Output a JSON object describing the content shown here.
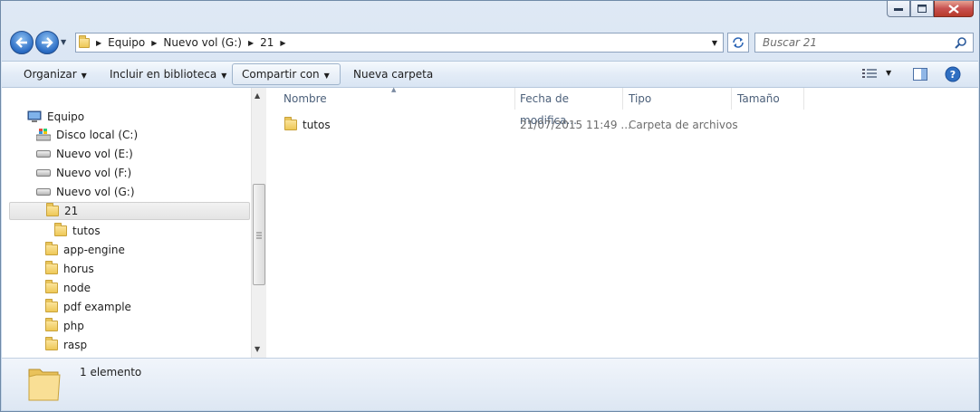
{
  "address": {
    "crumbs": [
      "Equipo",
      "Nuevo vol (G:)",
      "21"
    ]
  },
  "search": {
    "placeholder": "Buscar 21"
  },
  "toolbar": {
    "organize": "Organizar",
    "include_library": "Incluir en biblioteca",
    "share": "Compartir con",
    "new_folder": "Nueva carpeta"
  },
  "tree": [
    {
      "label": "Equipo",
      "icon": "computer-icon"
    },
    {
      "label": "Disco local (C:)",
      "icon": "drive-windows-icon"
    },
    {
      "label": "Nuevo vol (E:)",
      "icon": "drive-icon"
    },
    {
      "label": "Nuevo vol (F:)",
      "icon": "drive-icon"
    },
    {
      "label": "Nuevo vol (G:)",
      "icon": "drive-icon"
    },
    {
      "label": "21",
      "icon": "folder-icon",
      "selected": true
    },
    {
      "label": "tutos",
      "icon": "folder-icon"
    },
    {
      "label": "app-engine",
      "icon": "folder-icon"
    },
    {
      "label": "horus",
      "icon": "folder-icon"
    },
    {
      "label": "node",
      "icon": "folder-icon"
    },
    {
      "label": "pdf example",
      "icon": "folder-icon"
    },
    {
      "label": "php",
      "icon": "folder-icon"
    },
    {
      "label": "rasp",
      "icon": "folder-icon"
    }
  ],
  "columns": {
    "name": "Nombre",
    "modified": "Fecha de modifica...",
    "type": "Tipo",
    "size": "Tamaño"
  },
  "files": [
    {
      "name": "tutos",
      "modified": "21/07/2015 11:49 ...",
      "type": "Carpeta de archivos",
      "size": ""
    }
  ],
  "status": {
    "count": "1 elemento"
  }
}
